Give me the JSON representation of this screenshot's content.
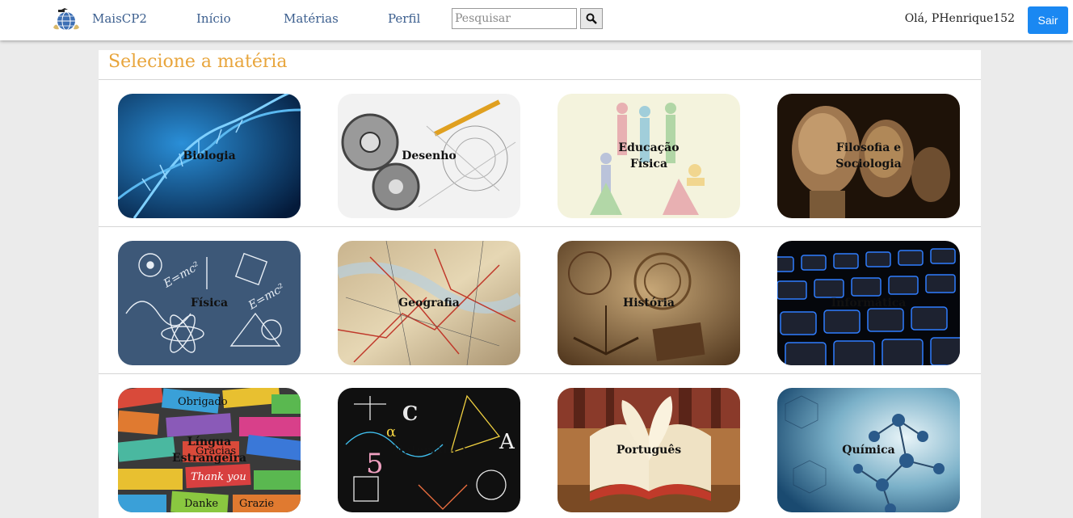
{
  "nav": {
    "brand": "MaisCP2",
    "links": [
      "Início",
      "Matérias",
      "Perfil"
    ],
    "search_placeholder": "Pesquisar",
    "greeting": "Olá, PHenrique152",
    "logout_label": "Sair"
  },
  "page": {
    "title": "Selecione a matéria"
  },
  "subjects": [
    "Biologia",
    "Desenho",
    "Educação Física",
    "Filosofia e Sociologia",
    "Física",
    "Geografia",
    "História",
    "Informática",
    "Língua Estrangeira",
    "Matemática",
    "Português",
    "Química"
  ],
  "colors": {
    "link": "#3b5e8e",
    "title": "#e8a53c",
    "button": "#1a88f2",
    "background": "#ebebeb"
  }
}
